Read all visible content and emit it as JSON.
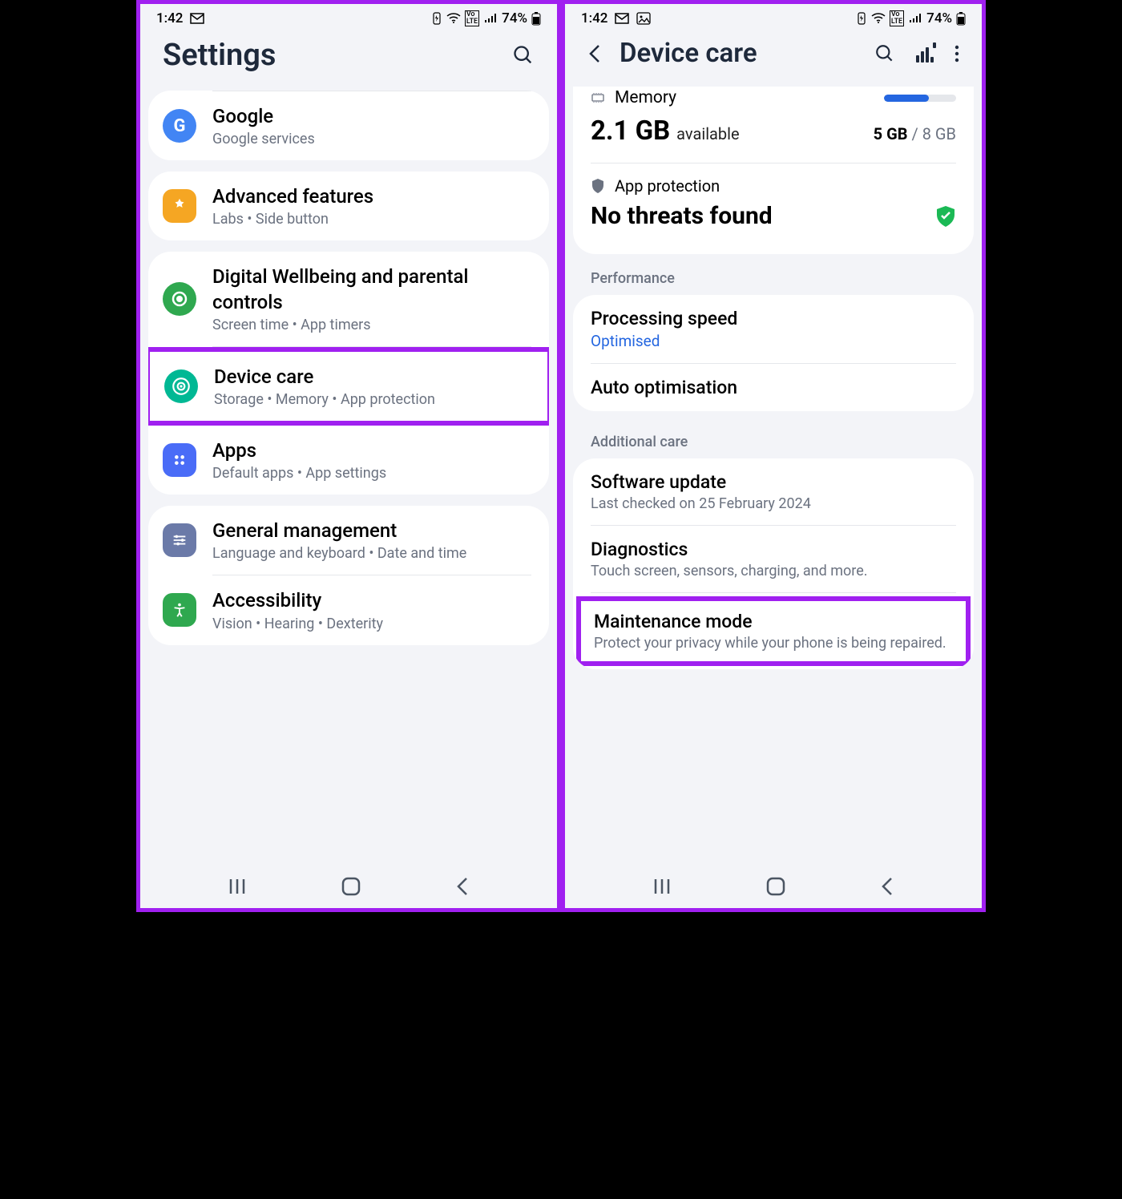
{
  "status": {
    "time": "1:42",
    "battery": "74%"
  },
  "left": {
    "title": "Settings",
    "items": [
      {
        "title": "Google",
        "sub": "Google services"
      },
      {
        "title": "Advanced features",
        "sub": "Labs  •  Side button"
      },
      {
        "title": "Digital Wellbeing and parental controls",
        "sub": "Screen time  •  App timers"
      },
      {
        "title": "Device care",
        "sub": "Storage  •  Memory  •  App protection"
      },
      {
        "title": "Apps",
        "sub": "Default apps  •  App settings"
      },
      {
        "title": "General management",
        "sub": "Language and keyboard  •  Date and time"
      },
      {
        "title": "Accessibility",
        "sub": "Vision  •  Hearing  •  Dexterity"
      }
    ]
  },
  "right": {
    "title": "Device care",
    "memory": {
      "label": "Memory",
      "value": "2.1 GB",
      "avail": "available",
      "used": "5 GB",
      "total": "8 GB"
    },
    "protection": {
      "label": "App protection",
      "status": "No threats found"
    },
    "sections": {
      "perf": "Performance",
      "add": "Additional care"
    },
    "perf": [
      {
        "title": "Processing speed",
        "val": "Optimised"
      },
      {
        "title": "Auto optimisation"
      }
    ],
    "additional": [
      {
        "title": "Software update",
        "sub": "Last checked on 25 February 2024"
      },
      {
        "title": "Diagnostics",
        "sub": "Touch screen, sensors, charging, and more."
      },
      {
        "title": "Maintenance mode",
        "sub": "Protect your privacy while your phone is being repaired."
      }
    ]
  }
}
